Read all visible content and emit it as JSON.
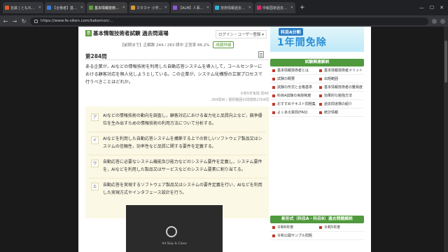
{
  "browser": {
    "tabs": [
      {
        "label": "名鉄 | ともれる 家族を持って",
        "color": "#e05a2b",
        "active": false
      },
      {
        "label": "【合格者】基本情報技術者",
        "color": "#3b7dd8",
        "active": false
      },
      {
        "label": "基本情報技術者試験過去問",
        "color": "#5a9c3a",
        "active": true
      },
      {
        "label": "カタカナ 小学校過去問",
        "color": "#d89b2b",
        "active": false
      },
      {
        "label": "【ALM】人事部向け",
        "color": "#8a5ad8",
        "active": false
      },
      {
        "label": "技術情報過去問題集",
        "color": "#2bb5d8",
        "active": false
      },
      {
        "label": "中級国家過去問題",
        "color": "#d82b6a",
        "active": false
      }
    ],
    "url": "https://www.fe-siken.com/kakomon/..."
  },
  "header": {
    "site_title": "基本情報技術者試験 過去問道場",
    "login": "ログイン・ユーザー登録 ▾"
  },
  "stats": {
    "text": "【前問まで】正解数 244 / 283 問中 正答率 86.2%",
    "badge": "成績詳細"
  },
  "question": {
    "number": "第284問",
    "body": "ある企業が，AIなどの情報技術を利用した自動応答システムを導入して，コールセンターにおける顧客対応を無人化しようとしている。この企業が，システム化構想の立案プロセスで行うべきことはどれか。",
    "meta_line1": "令和5年免除 問48",
    "meta_line2": "284問目 / 選択範囲の問題数2354問"
  },
  "choices": [
    {
      "letter": "ア",
      "text": "AIなどの情報技術の動向を調査し，顧客対応における省力化と品質向上など，競争優位を生み出すための情報技術の利用方法について分析する。"
    },
    {
      "letter": "イ",
      "text": "AIなどを利用した自動応答システムを構築する上での新しいソフトウェア製品又はシステムの信頼性，効率性など品質に関する要件を定義する。"
    },
    {
      "letter": "ウ",
      "text": "自動応答に必要なシステム機能及び能力などのシステム要件を定義し，システム要件を，AIなどを利用した製品又はサービスなどのシステム要素に割り当てる。"
    },
    {
      "letter": "エ",
      "text": "自動応答を実現するソフトウェア製品又はシステムの要件定義を行い，AIなどを利用した実現方式やインタフェース設計を行う。"
    }
  ],
  "ad": {
    "caption": "Ad Skip & Close"
  },
  "sidebar": {
    "banner_tag": "科目A分割",
    "banner_text": "1年間免除",
    "info_head": "試験関連解説",
    "info_items": [
      "基本情報技術者とは",
      "基本情報技術者メリット",
      "試験の概要",
      "出題範囲",
      "試験の形式と合格基準",
      "基本情報技術者の難易度",
      "科目A試験の免除制度",
      "効果的な勉強方法",
      "おすすめテキスト問題集",
      "過去問道場の紹介",
      "よくある質問(FAQ)",
      "統計情報"
    ],
    "past_head": "新形式（科目A・科目B）過去問題解説",
    "past_items": [
      "令和6年度",
      "令和5年度",
      "令和公開サンプル問題",
      ""
    ]
  }
}
